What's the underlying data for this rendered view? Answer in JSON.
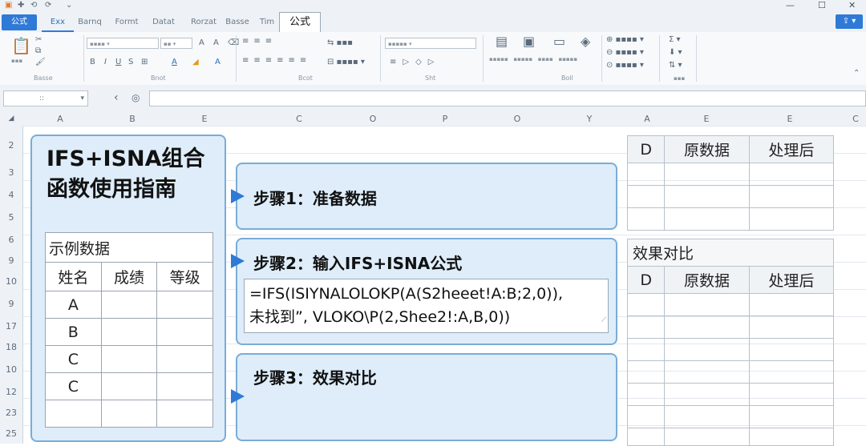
{
  "ribbon_tabs": [
    "公式",
    "Exx",
    "Barnq",
    "Formt",
    "Datat",
    "Rorzat",
    "Basse",
    "Tim",
    "公式"
  ],
  "name_box": "::",
  "column_headers": [
    "A",
    "B",
    "E",
    "C",
    "O",
    "P",
    "O",
    "Y",
    "A",
    "E",
    "E",
    "C"
  ],
  "row_numbers": [
    "2",
    "3",
    "4",
    "5",
    "6",
    "9",
    "10",
    "9",
    "17",
    "18",
    "10",
    "12",
    "23",
    "25"
  ],
  "guide": {
    "title": "IFS+ISNA组合函数使用指南",
    "example_title": "示例数据",
    "table_headers": [
      "姓名",
      "成绩",
      "等级"
    ],
    "rows": [
      [
        "A",
        "",
        ""
      ],
      [
        "B",
        "",
        ""
      ],
      [
        "C",
        "",
        ""
      ],
      [
        "C",
        "",
        ""
      ],
      [
        "",
        "",
        ""
      ]
    ]
  },
  "steps": [
    {
      "label": "步骤1：准备数据"
    },
    {
      "label": "步骤2：输入IFS+ISNA公式",
      "formula_line1": "=IFS(ISIYNALOLOKP(A(S2heeet!A:B;2,0)),",
      "formula_line2": "未找到”, VLOKO\\P(2,Shee2!:A,B,0))"
    },
    {
      "label": "步骤3：效果对比"
    }
  ],
  "right_table_1": {
    "headers": [
      "D",
      "原数据",
      "处理后"
    ]
  },
  "right_table_2": {
    "title": "效果对比",
    "headers": [
      "D",
      "原数据",
      "处理后"
    ]
  },
  "ribbon_groups": [
    "Basse",
    "Bnot",
    "Bcot",
    "Sht",
    "Boll"
  ]
}
